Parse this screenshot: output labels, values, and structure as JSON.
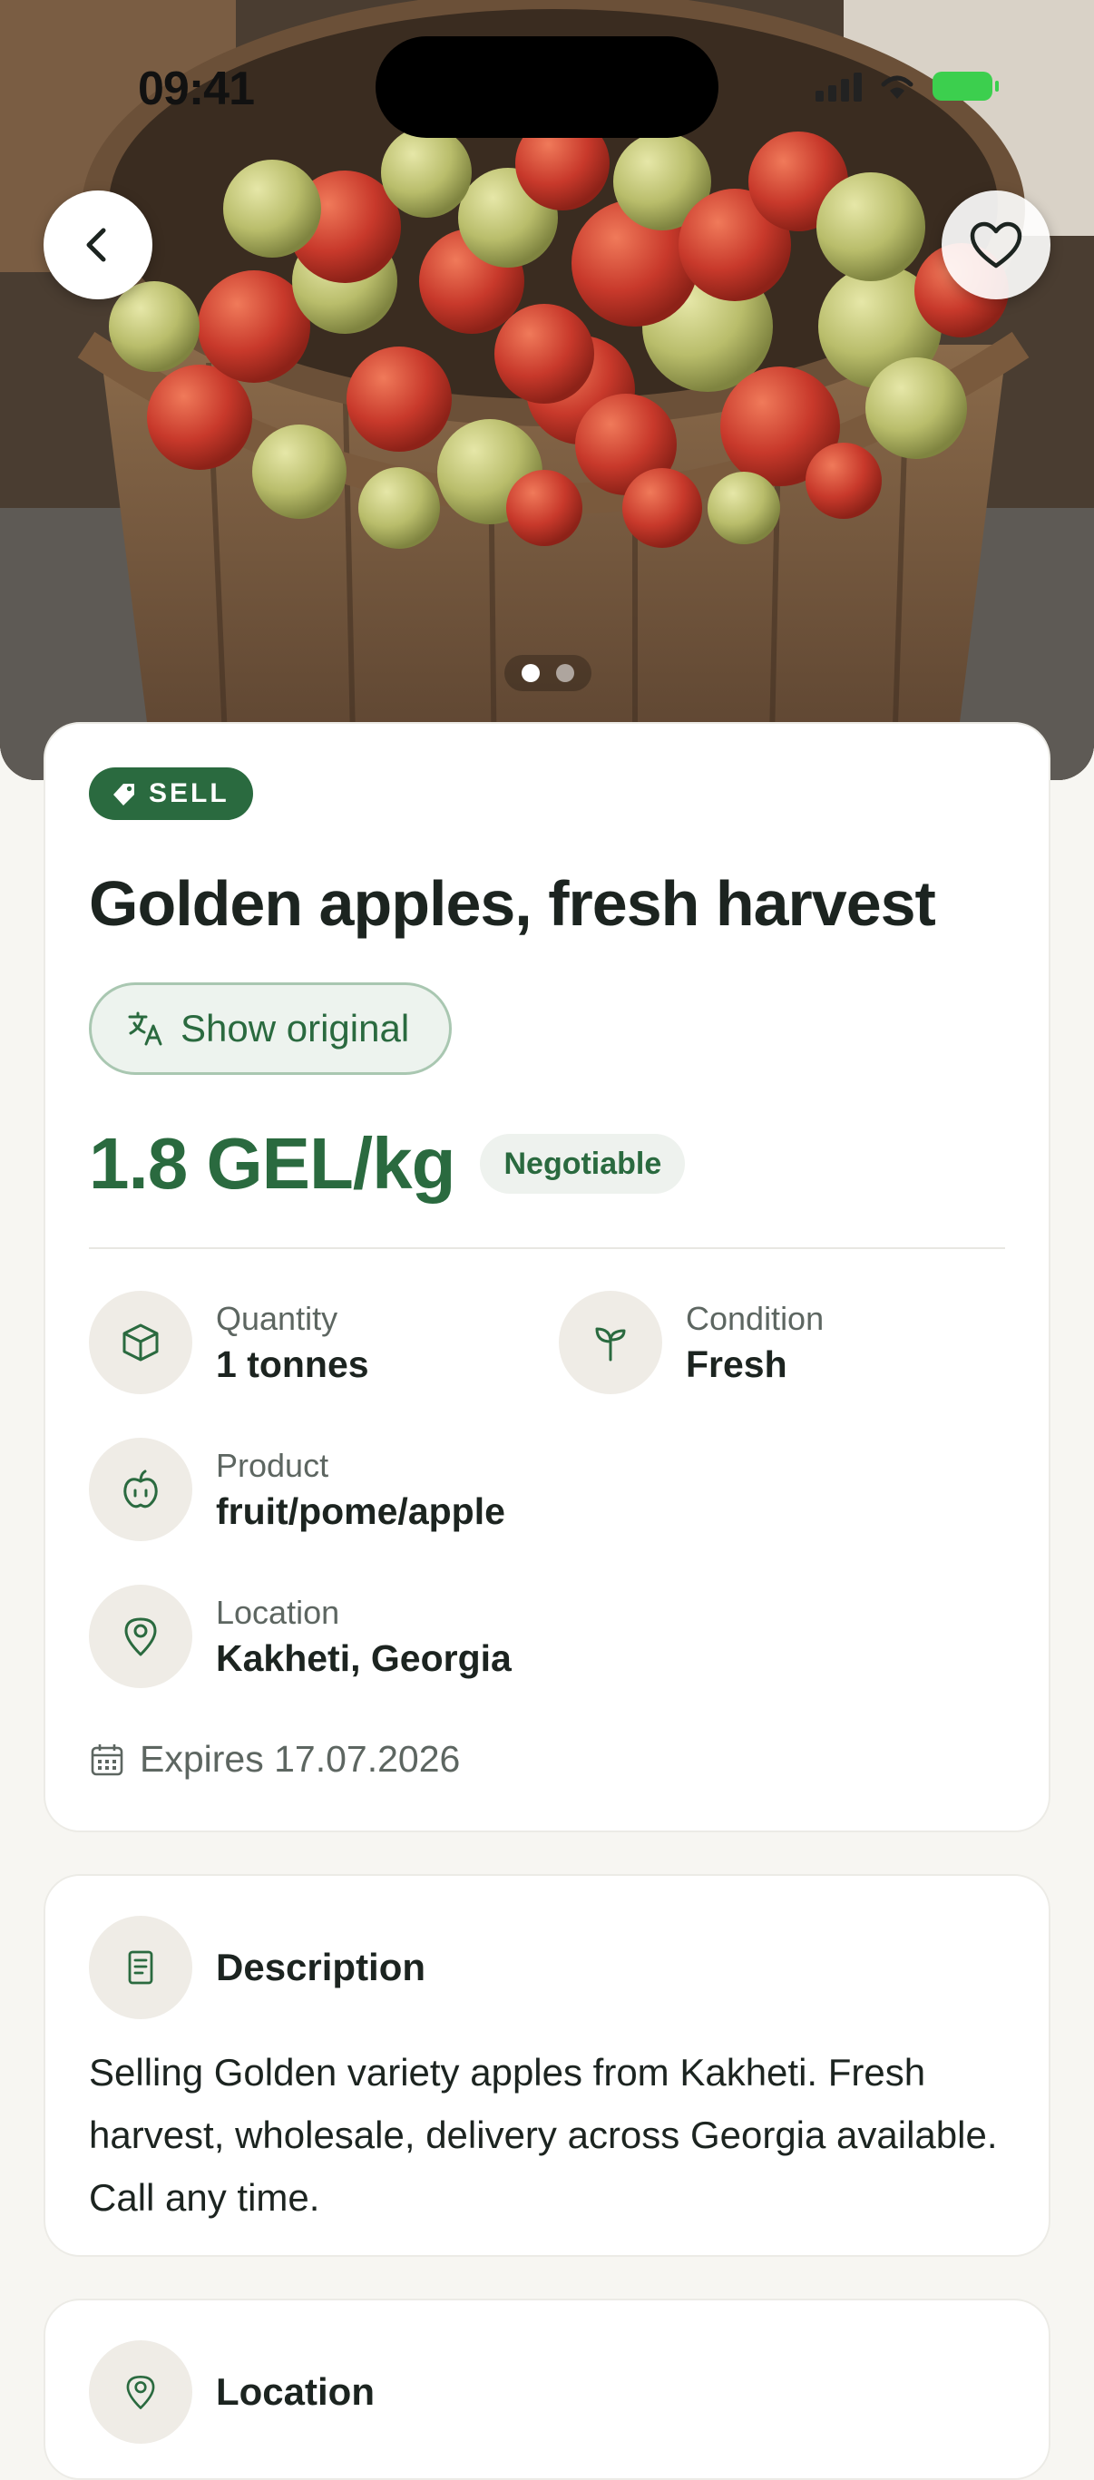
{
  "status_bar": {
    "time": "09:41"
  },
  "hero": {
    "image_alt": "Basket of red and green apples",
    "slide_count": 2,
    "active_slide": 1
  },
  "listing": {
    "type_badge": "SELL",
    "title": "Golden apples, fresh harvest",
    "show_original_label": "Show original",
    "price": "1.8 GEL/kg",
    "negotiable_label": "Negotiable",
    "facts": [
      {
        "label": "Quantity",
        "value": "1 tonnes",
        "icon": "box-icon"
      },
      {
        "label": "Condition",
        "value": "Fresh",
        "icon": "sprout-icon"
      },
      {
        "label": "Product",
        "value": "fruit/pome/apple",
        "icon": "apple-icon"
      },
      {
        "label": "Location",
        "value": "Kakheti, Georgia",
        "icon": "location-pin-icon"
      }
    ],
    "expires": "Expires 17.07.2026"
  },
  "description": {
    "title": "Description",
    "text": "Selling Golden variety apples from Kakheti. Fresh harvest, wholesale, delivery across Georgia available. Call any time."
  },
  "location_section": {
    "title": "Location"
  },
  "colors": {
    "brand_green": "#2a6a3f",
    "background": "#f7f6f2",
    "chip_bg": "#efece6"
  }
}
